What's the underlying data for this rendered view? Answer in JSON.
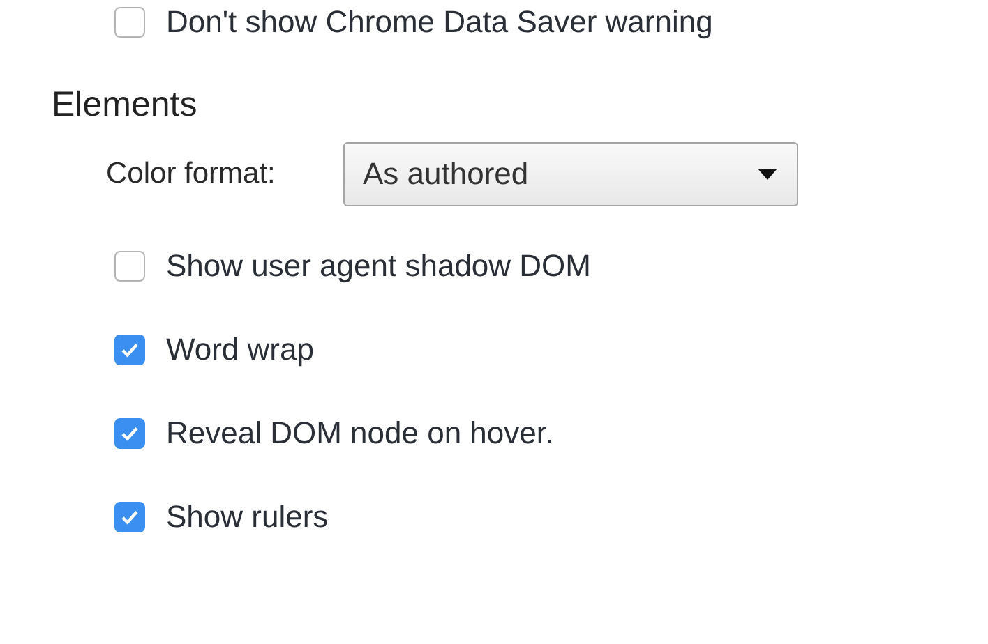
{
  "top_checkbox": {
    "label": "Don't show Chrome Data Saver warning",
    "checked": false
  },
  "section": {
    "title": "Elements",
    "color_format": {
      "label": "Color format:",
      "value": "As authored"
    },
    "options": [
      {
        "label": "Show user agent shadow DOM",
        "checked": false
      },
      {
        "label": "Word wrap",
        "checked": true
      },
      {
        "label": "Reveal DOM node on hover.",
        "checked": true
      },
      {
        "label": "Show rulers",
        "checked": true
      }
    ]
  }
}
